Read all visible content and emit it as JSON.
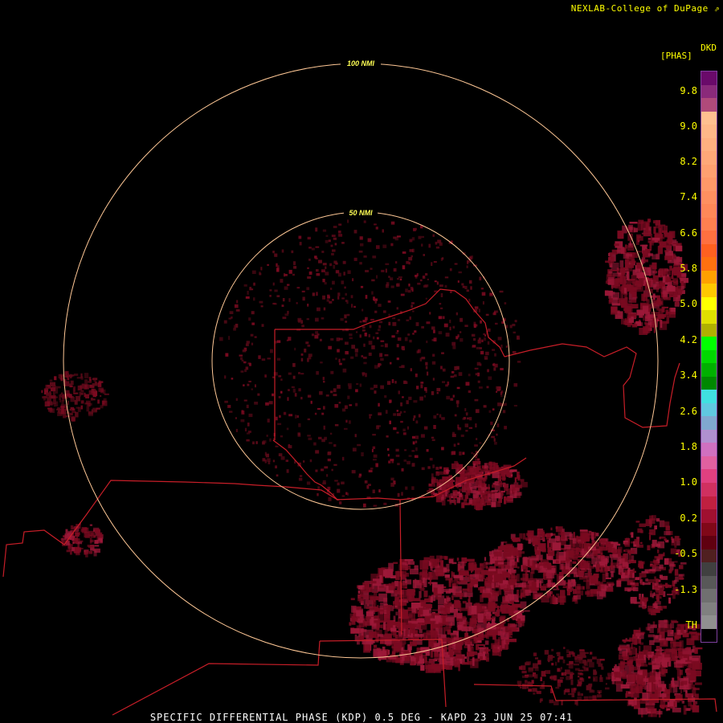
{
  "credit": "NEXLAB-College of DuPage",
  "credit_icon": "external-link-icon",
  "bottom_title": "SPECIFIC DIFFERENTIAL PHASE (KDP) 0.5 DEG - KAPD 23 JUN 25 07:41",
  "range_rings": [
    {
      "label": "100 NMI",
      "range_nmi": 100
    },
    {
      "label": "50 NMI",
      "range_nmi": 50
    }
  ],
  "colors": {
    "ring": "#ffc896",
    "ring_label": "#ffff55",
    "boundary": "#c81e28",
    "echo": "#7a0a20",
    "echo_bright": "#9c1838"
  },
  "colorbar": {
    "unit_top": "DKD",
    "unit_sub": "[PHAS]",
    "labels": [
      "9.8",
      "9.0",
      "8.2",
      "7.4",
      "6.6",
      "5.8",
      "5.0",
      "4.2",
      "3.4",
      "2.6",
      "1.8",
      "1.0",
      "0.2",
      "-0.5",
      "-1.3",
      "TH"
    ],
    "colors": [
      "#6a0a6a",
      "#8a2a7a",
      "#b04a7a",
      "#ffc090",
      "#ffb888",
      "#ffb080",
      "#ffa878",
      "#ffa070",
      "#ff9868",
      "#ff9060",
      "#ff8858",
      "#ff8050",
      "#ff7040",
      "#ff6020",
      "#ff7010",
      "#ffa000",
      "#ffc800",
      "#ffff00",
      "#e0e000",
      "#b0b000",
      "#00ff00",
      "#00d800",
      "#00b000",
      "#008800",
      "#40e0e0",
      "#60c8e0",
      "#80a8d0",
      "#b090d0",
      "#d070c0",
      "#e060a0",
      "#e04080",
      "#d03060",
      "#c02040",
      "#a01030",
      "#800818",
      "#600010",
      "#502020",
      "#404040",
      "#585858",
      "#707070",
      "#808080",
      "#909090",
      "#000000"
    ]
  }
}
